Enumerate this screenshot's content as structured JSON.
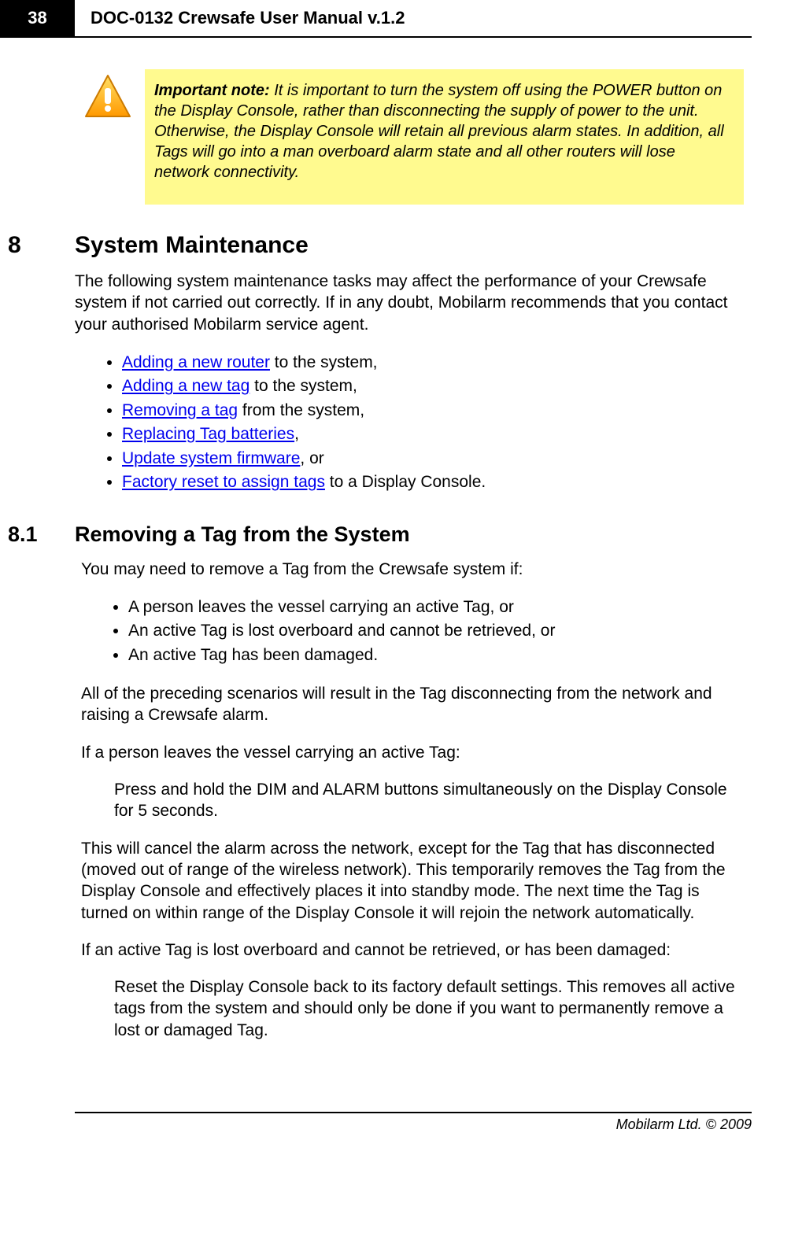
{
  "header": {
    "page_number": "38",
    "doc_title": "DOC-0132 Crewsafe User Manual v.1.2"
  },
  "note": {
    "label": "Important  note:",
    "text": " It is important to turn the system off using the POWER button on the Display Console, rather than disconnecting the supply of power to the unit. Otherwise, the Display Console will retain all previous alarm states. In addition, all Tags will go into a man overboard alarm state and all other routers will lose network connectivity."
  },
  "section8": {
    "num": "8",
    "title": "System Maintenance",
    "intro": "The following system maintenance tasks may affect the performance of your Crewsafe system if not carried out correctly. If in any doubt, Mobilarm recommends that you contact your authorised Mobilarm service agent.",
    "links": [
      {
        "link": "Adding a new router",
        "tail": " to the system,"
      },
      {
        "link": "Adding a new tag",
        "tail": " to the system,"
      },
      {
        "link": "Removing a tag",
        "tail": " from the system,"
      },
      {
        "link": "Replacing Tag batteries",
        "tail": ","
      },
      {
        "link": "Update system firmware",
        "tail": ", or"
      },
      {
        "link": "Factory reset to assign tags",
        "tail": " to a Display Console."
      }
    ]
  },
  "section81": {
    "num": "8.1",
    "title": "Removing a Tag from the System",
    "intro": "You may need to remove a Tag from the Crewsafe system if:",
    "reasons": [
      "A person leaves the vessel carrying an active Tag, or",
      "An active Tag is lost overboard and cannot be retrieved, or",
      "An active Tag has been damaged."
    ],
    "para1": "All of the preceding scenarios will result in the Tag disconnecting from the network and raising a Crewsafe alarm.",
    "para2": "If a person leaves the vessel carrying an active Tag:",
    "step1": "Press and hold the DIM and ALARM buttons simultaneously on the Display Console for 5 seconds.",
    "para3": "This will cancel the alarm across the network, except for the Tag that has disconnected (moved out of range of the wireless network). This temporarily removes the Tag from the Display Console and effectively places it into standby mode. The next time the Tag is turned on within range of the Display Console it will rejoin the network automatically.",
    "para4": "If an active Tag is lost overboard and cannot be retrieved, or has been damaged:",
    "step2": " Reset the Display Console back to its factory default settings. This removes all active tags from the system and should only be done if you want to permanently remove a lost or damaged Tag."
  },
  "footer": "Mobilarm Ltd. © 2009"
}
